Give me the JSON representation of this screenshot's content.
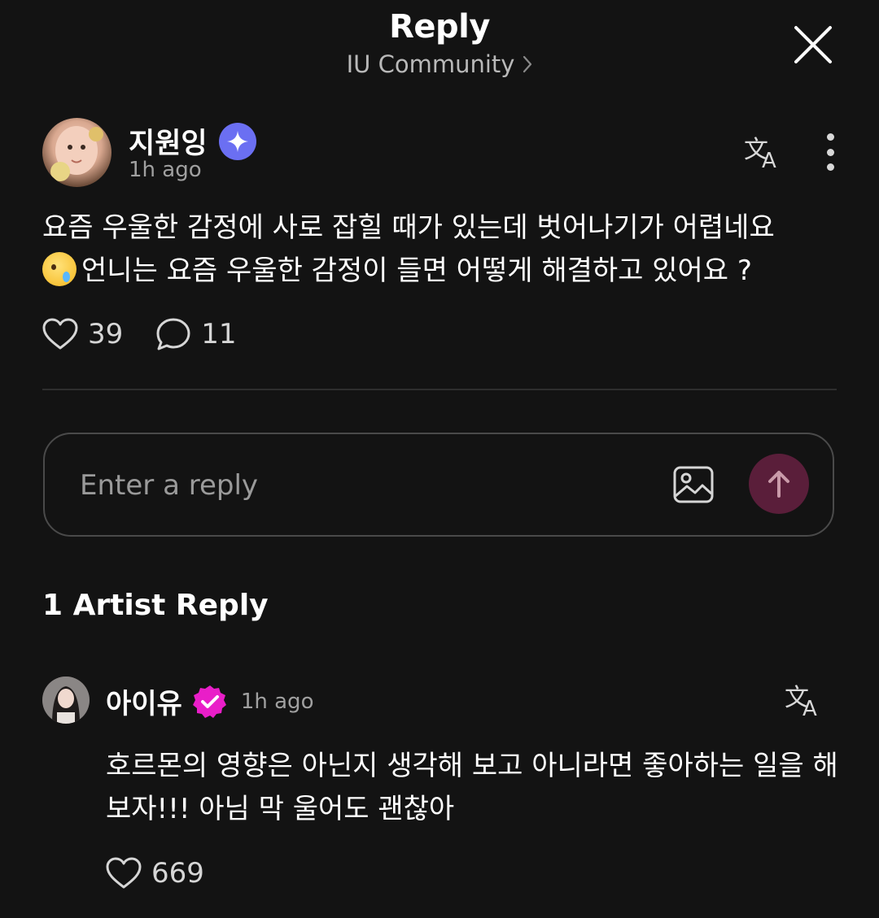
{
  "header": {
    "title": "Reply",
    "community": "IU Community"
  },
  "post": {
    "username": "지원잉",
    "time": "1h ago",
    "body": "요즘 우울한 감정에 사로 잡힐 때가 있는데 벗어나기가 어렵네요",
    "body_line2": "언니는 요즘 우울한 감정이 들면 어떻게 해결하고 있어요 ?",
    "emoji": "face-holding-back-tears",
    "likes": "39",
    "comments": "11"
  },
  "reply_input": {
    "placeholder": "Enter a reply"
  },
  "artist_section": {
    "title": "1 Artist Reply"
  },
  "artist_reply": {
    "username": "아이유",
    "time": "1h ago",
    "body": "호르몬의 영향은 아닌지 생각해 보고 아니라면 좋아하는 일을 해보자!!! 아님 막 울어도 괜찮아",
    "likes": "669"
  },
  "colors": {
    "background": "#131313",
    "verified_fan": "#6b6ff2",
    "verified_artist": "#e91ec8",
    "send_button": "#5a1e3a"
  }
}
